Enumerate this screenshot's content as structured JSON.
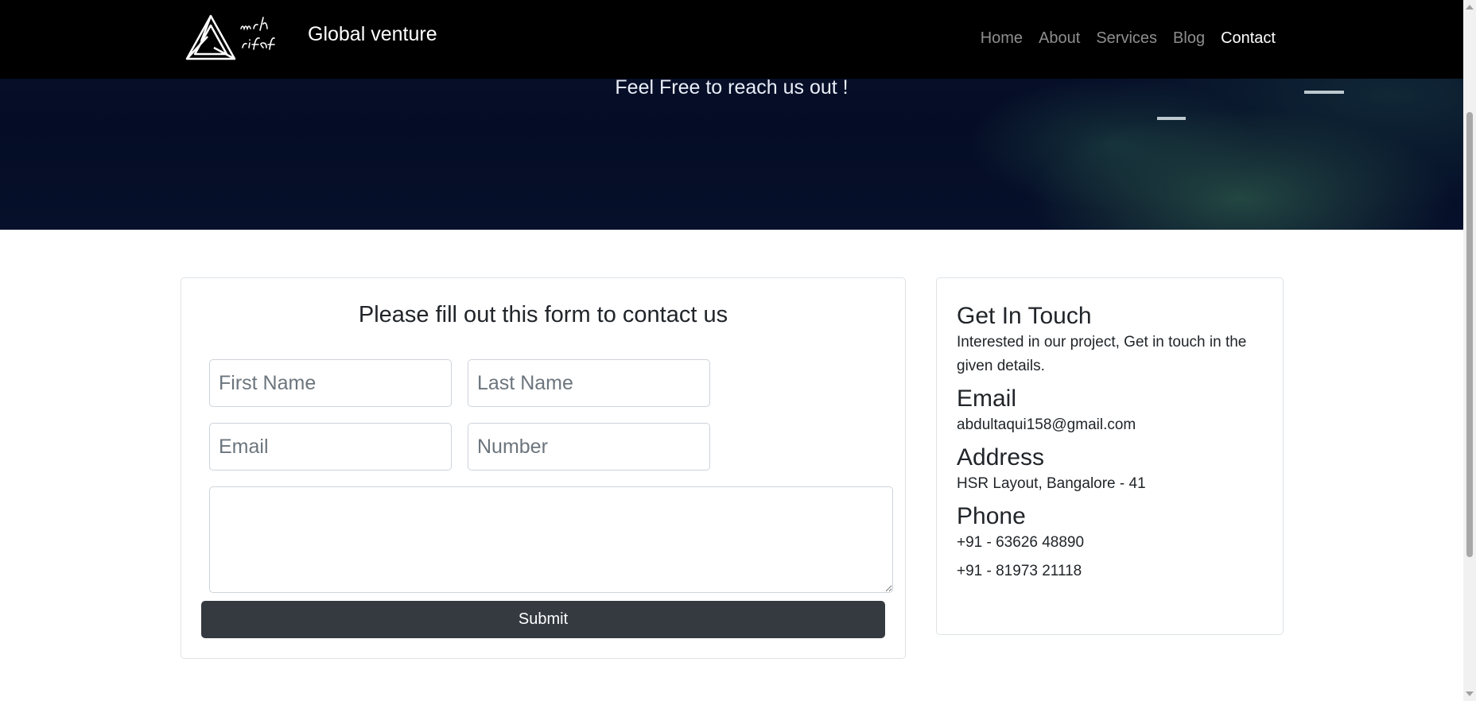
{
  "brand": {
    "logo_alt": "mrh rifat",
    "name": "Global venture"
  },
  "nav": {
    "items": [
      {
        "label": "Home",
        "active": false
      },
      {
        "label": "About",
        "active": false
      },
      {
        "label": "Services",
        "active": false
      },
      {
        "label": "Blog",
        "active": false
      },
      {
        "label": "Contact",
        "active": true
      }
    ]
  },
  "hero": {
    "tagline": "Feel Free to reach us out !"
  },
  "form": {
    "title": "Please fill out this form to contact us",
    "first_name_placeholder": "First Name",
    "last_name_placeholder": "Last Name",
    "email_placeholder": "Email",
    "number_placeholder": "Number",
    "message_value": "",
    "submit_label": "Submit"
  },
  "info": {
    "title": "Get In Touch",
    "intro": "Interested in our project, Get in touch in the given details.",
    "email_heading": "Email",
    "email_value": "abdultaqui158@gmail.com",
    "address_heading": "Address",
    "address_value": "HSR Layout, Bangalore - 41",
    "phone_heading": "Phone",
    "phone_1": "+91 - 63626 48890",
    "phone_2": "+91 - 81973 21118"
  },
  "colors": {
    "navbar_bg": "#000000",
    "hero_bg": "#06102a",
    "submit_bg": "#343a40",
    "card_border": "#dee2e6"
  }
}
